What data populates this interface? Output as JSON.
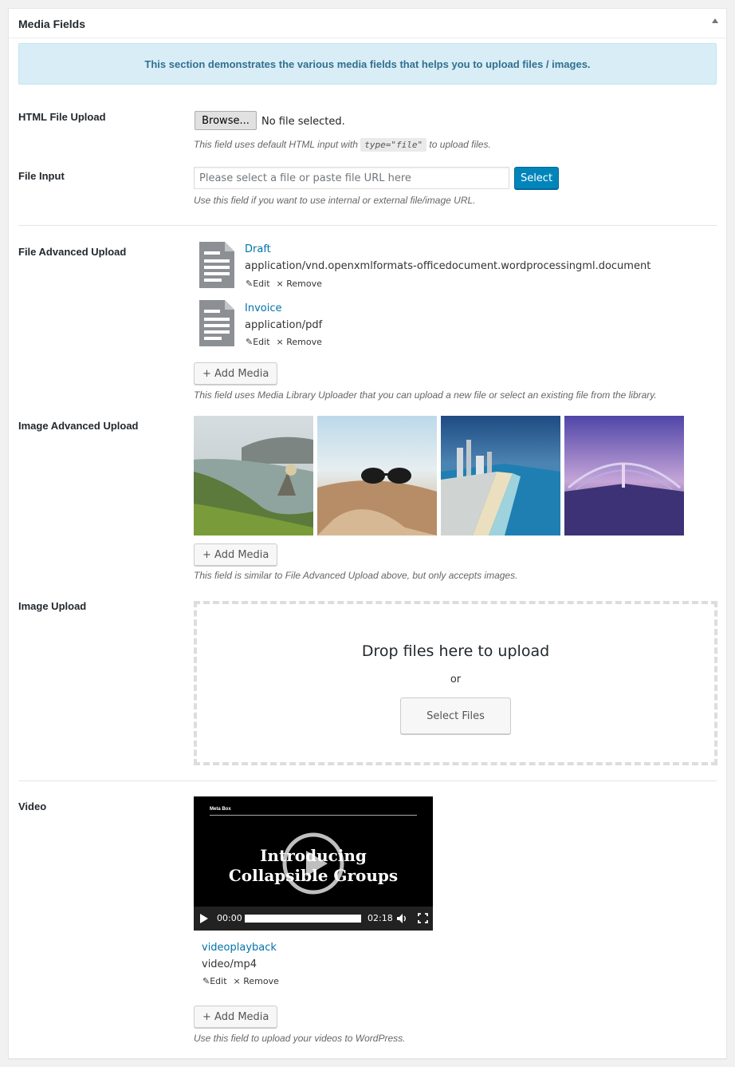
{
  "box": {
    "title": "Media Fields"
  },
  "notice": "This section demonstrates the various media fields that helps you to upload files / images.",
  "html_file": {
    "label": "HTML File Upload",
    "button": "Browse...",
    "status": "No file selected.",
    "desc_before": "This field uses default HTML input with",
    "desc_code": "type=\"file\"",
    "desc_after": "to upload files."
  },
  "file_input": {
    "label": "File Input",
    "placeholder": "Please select a file or paste file URL here",
    "button": "Select",
    "desc": "Use this field if you want to use internal or external file/image URL."
  },
  "file_advanced": {
    "label": "File Advanced Upload",
    "files": [
      {
        "title": "Draft",
        "mime": "application/vnd.openxmlformats-officedocument.wordprocessingml.document",
        "edit": "Edit",
        "remove": "Remove"
      },
      {
        "title": "Invoice",
        "mime": "application/pdf",
        "edit": "Edit",
        "remove": "Remove"
      }
    ],
    "add_button": "+ Add Media",
    "desc": "This field uses Media Library Uploader that you can upload a new file or select an existing file from the library."
  },
  "image_advanced": {
    "label": "Image Advanced Upload",
    "add_button": "+ Add Media",
    "desc": "This field is similar to File Advanced Upload above, but only accepts images."
  },
  "image_upload": {
    "label": "Image Upload",
    "drop_text": "Drop files here to upload",
    "or": "or",
    "button": "Select Files"
  },
  "video": {
    "label": "Video",
    "brand": "Meta Box",
    "overlay_title": "Introducing Collapsible Groups",
    "current_time": "00:00",
    "duration": "02:18",
    "progress": 0,
    "file_title": "videoplayback",
    "file_mime": "video/mp4",
    "edit": "Edit",
    "remove": "Remove",
    "add_button": "+ Add Media",
    "desc": "Use this field to upload your videos to WordPress."
  },
  "colors": {
    "accent": "#0073aa",
    "primary": "#0085ba",
    "notice_bg": "#d9edf7",
    "notice_text": "#31708f"
  }
}
